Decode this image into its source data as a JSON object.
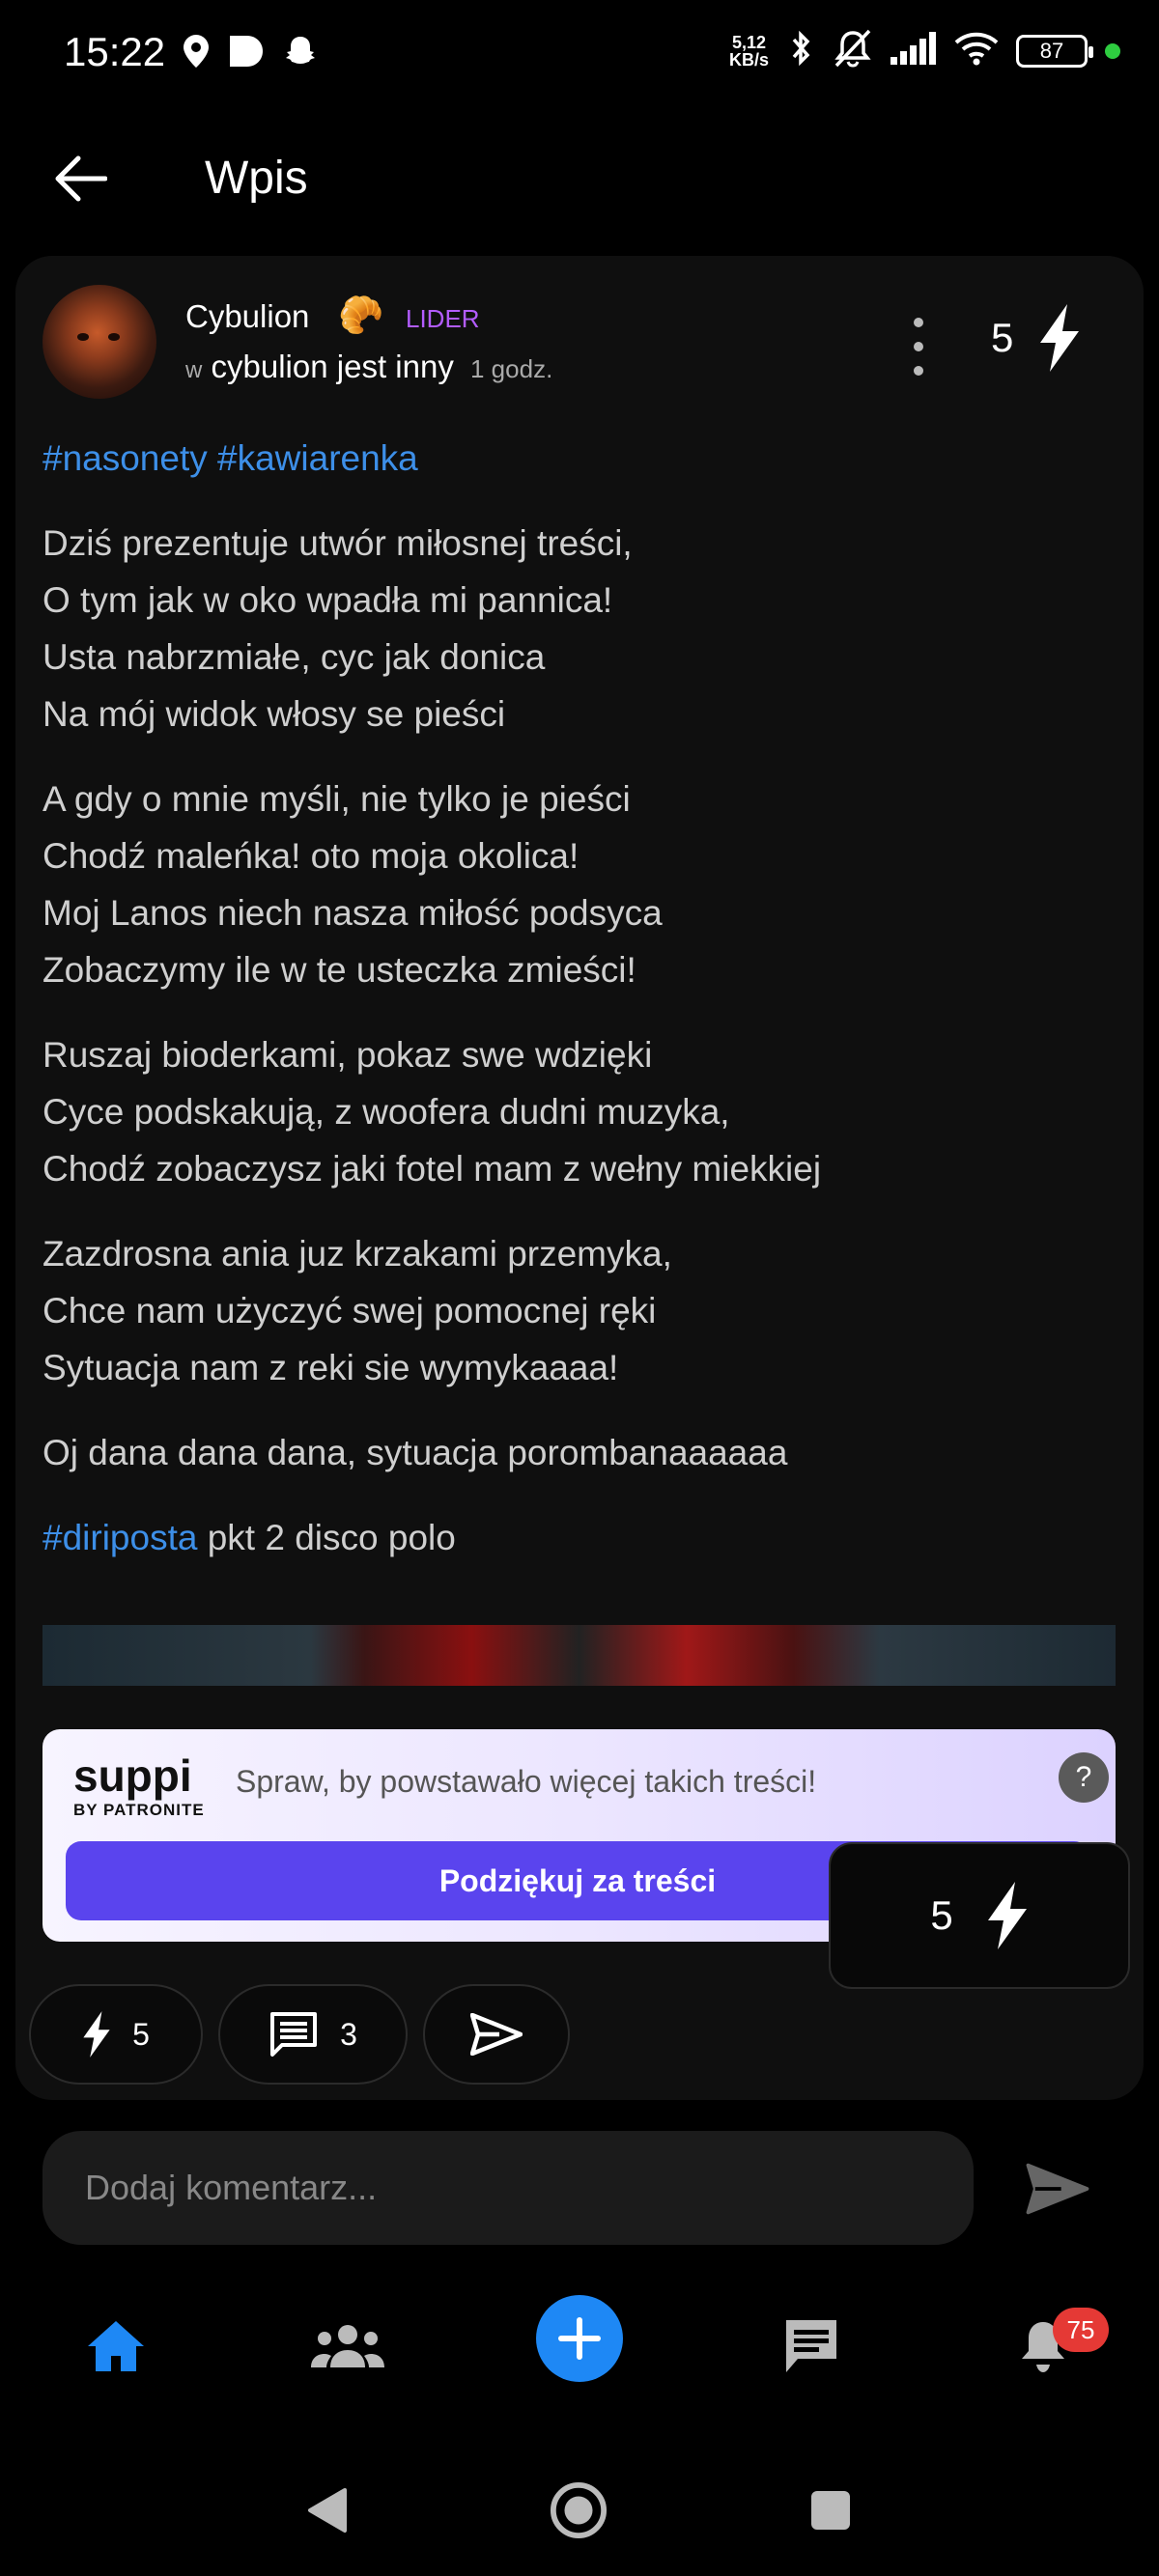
{
  "status_bar": {
    "time": "15:22",
    "speed_value": "5,12",
    "speed_unit": "KB/s",
    "battery": "87",
    "icons": [
      "location-icon",
      "chat-bubble-icon",
      "snapchat-icon",
      "bluetooth-icon",
      "silent-icon",
      "signal-icon",
      "wifi-icon",
      "battery-icon"
    ]
  },
  "header": {
    "title": "Wpis"
  },
  "post": {
    "author": "Cybulion",
    "badge": "LIDER",
    "badge_emoji": "🥐",
    "in_prefix": "w",
    "community": "cybulion jest inny",
    "time_ago": "1 godz.",
    "votes": "5",
    "tags_line": [
      "#nasonety",
      "#kawiarenka"
    ],
    "stanzas": [
      [
        "Dziś prezentuje utwór miłosnej treści,",
        "O tym jak w oko wpadła mi pannica!",
        "Usta nabrzmiałe, cyc jak donica",
        "Na mój widok włosy se pieści"
      ],
      [
        "A gdy o mnie myśli, nie tylko je pieści",
        "Chodź maleńka! oto moja okolica!",
        "Moj Lanos niech nasza miłość podsyca",
        "Zobaczymy ile w te usteczka zmieści!"
      ],
      [
        "Ruszaj bioderkami, pokaz swe wdzięki",
        "Cyce podskakują, z woofera dudni muzyka,",
        "Chodź zobaczysz jaki fotel mam z wełny miekkiej"
      ],
      [
        "Zazdrosna ania juz krzakami przemyka,",
        "Chce nam użyczyć swej pomocnej ręki",
        "Sytuacja nam z reki sie wymykaaaa!"
      ],
      [
        "Oj dana dana dana, sytuacja porombanaaaaaa"
      ]
    ],
    "footer_tag": "#diriposta",
    "footer_text": " pkt 2 disco polo"
  },
  "suppi": {
    "logo": "suppi",
    "logo_sub": "BY PATRONITE",
    "text": "Spraw, by powstawało więcej takich treści!",
    "help": "?",
    "button": "Podziękuj za treści"
  },
  "floating_vote": {
    "count": "5"
  },
  "actions": {
    "votes": "5",
    "comments": "3"
  },
  "comment_box": {
    "placeholder": "Dodaj komentarz..."
  },
  "bottom_nav": {
    "notifications_count": "75",
    "accent_color": "#1e88f5"
  }
}
